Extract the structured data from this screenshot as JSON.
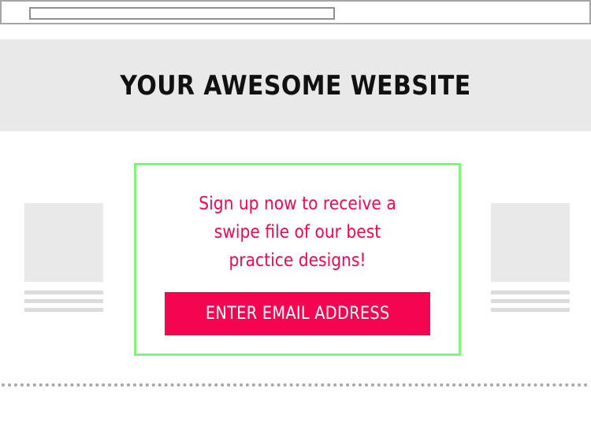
{
  "header": {
    "title": "YOUR AWESOME WEBSITE"
  },
  "optin": {
    "message": "Sign up now to receive a swipe file of our best practice designs!",
    "button_label": "ENTER EMAIL ADDRESS"
  },
  "colors": {
    "accent": "#f5044f",
    "optin_border": "#7cf77a",
    "header_background": "#e9e9e9",
    "placeholder": "#e9e9e9",
    "fold_line": "#a7a7a7"
  }
}
